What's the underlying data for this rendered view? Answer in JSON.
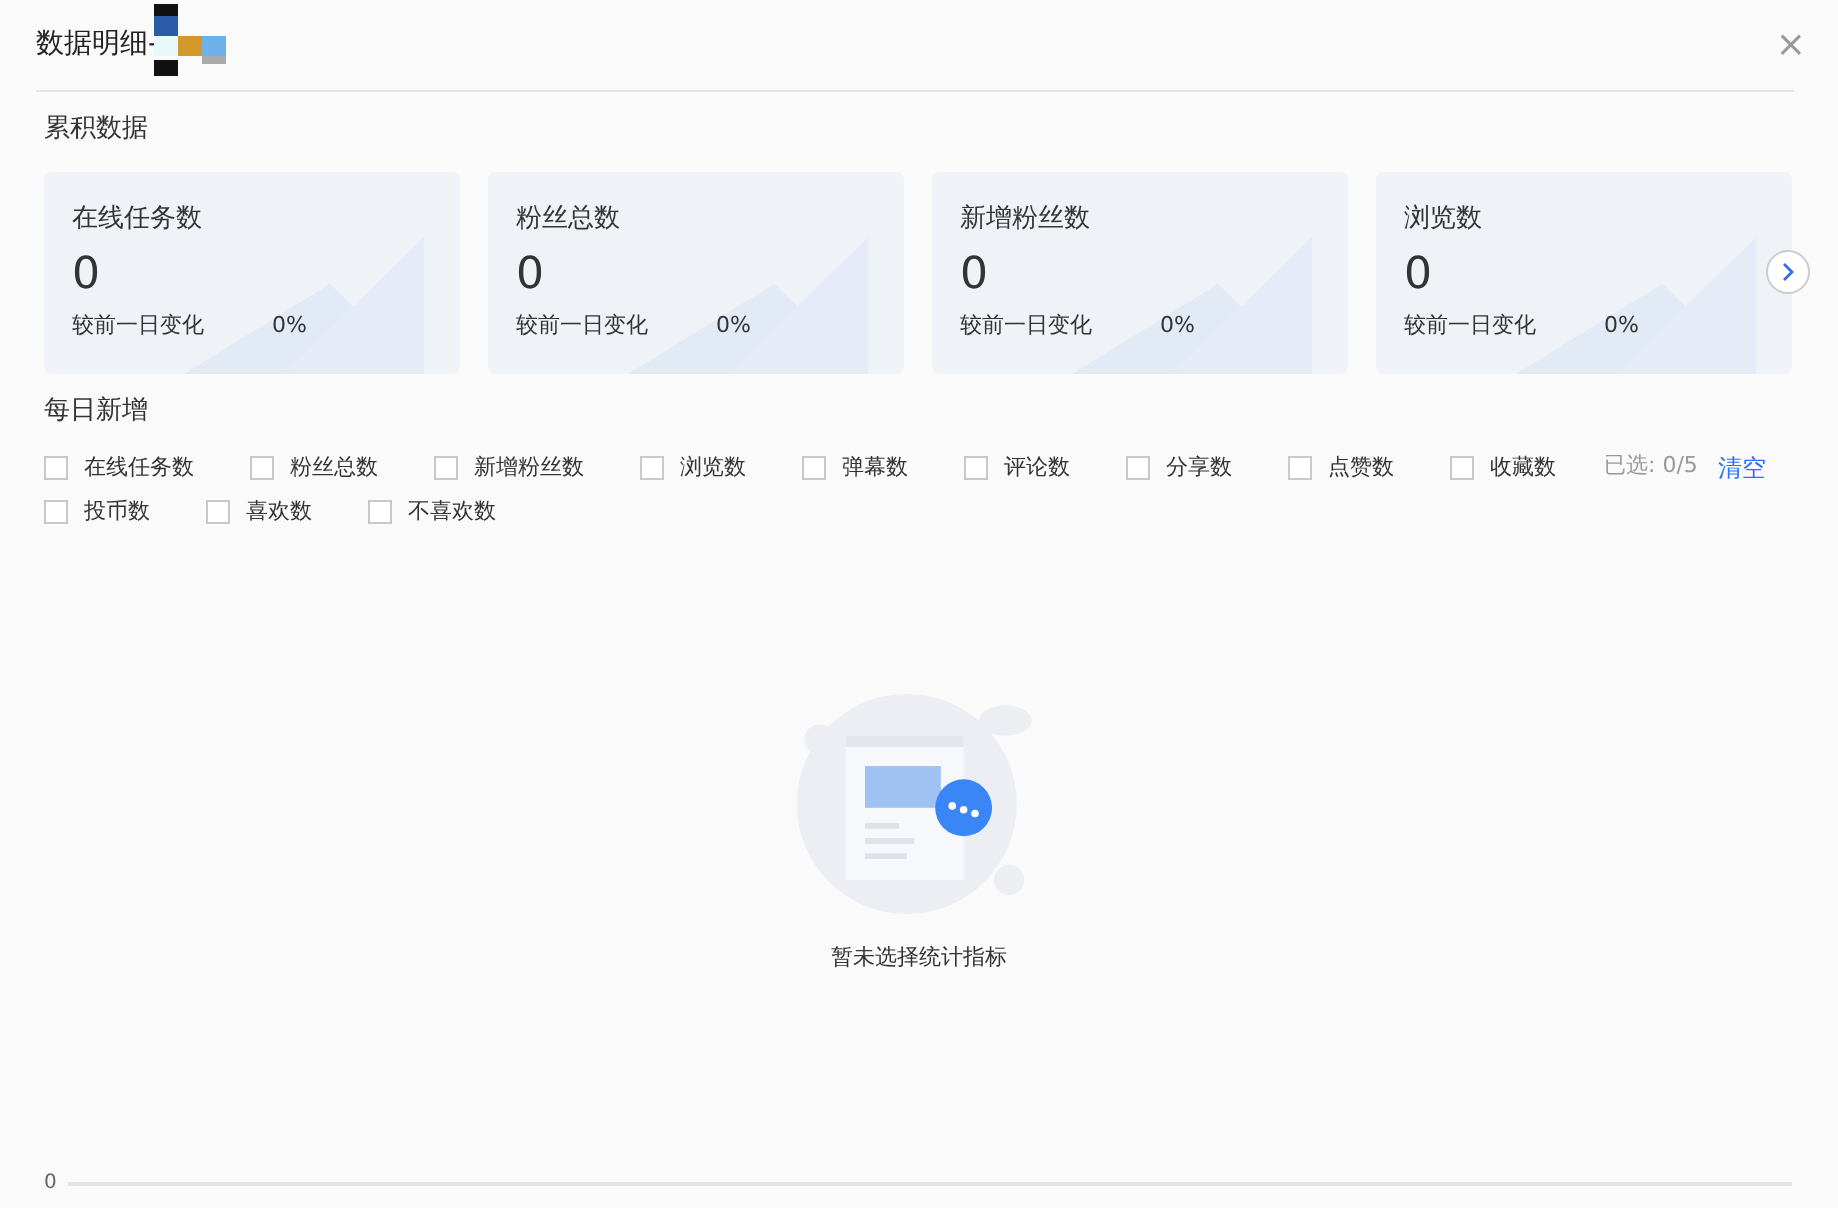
{
  "dialog": {
    "title": "数据明细-",
    "close": "×"
  },
  "cumulative": {
    "heading": "累积数据",
    "cards": [
      {
        "label": "在线任务数",
        "value": "0",
        "change_label": "较前一日变化",
        "change": "0%"
      },
      {
        "label": "粉丝总数",
        "value": "0",
        "change_label": "较前一日变化",
        "change": "0%"
      },
      {
        "label": "新增粉丝数",
        "value": "0",
        "change_label": "较前一日变化",
        "change": "0%"
      },
      {
        "label": "浏览数",
        "value": "0",
        "change_label": "较前一日变化",
        "change": "0%"
      }
    ]
  },
  "daily": {
    "heading": "每日新增",
    "metrics": [
      {
        "label": "在线任务数",
        "checked": false
      },
      {
        "label": "粉丝总数",
        "checked": false
      },
      {
        "label": "新增粉丝数",
        "checked": false
      },
      {
        "label": "浏览数",
        "checked": false
      },
      {
        "label": "弹幕数",
        "checked": false
      },
      {
        "label": "评论数",
        "checked": false
      },
      {
        "label": "分享数",
        "checked": false
      },
      {
        "label": "点赞数",
        "checked": false
      },
      {
        "label": "收藏数",
        "checked": false
      },
      {
        "label": "投币数",
        "checked": false
      },
      {
        "label": "喜欢数",
        "checked": false
      },
      {
        "label": "不喜欢数",
        "checked": false
      }
    ],
    "selected_count": "已选: 0/5",
    "clear": "清空",
    "empty_message": "暂未选择统计指标",
    "axis_tick": "0"
  }
}
